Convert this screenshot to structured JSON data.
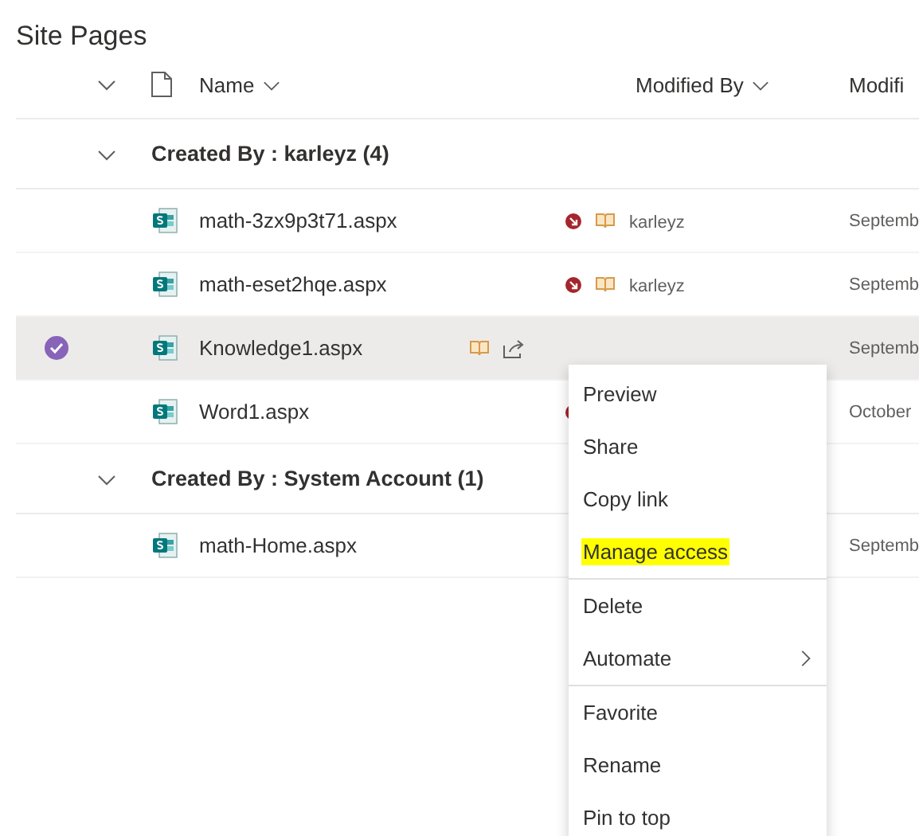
{
  "title": "Site Pages",
  "columns": [
    {
      "label": "Name",
      "sortable": true
    },
    {
      "label": "Modified By",
      "sortable": true
    },
    {
      "label": "Modifi",
      "sortable": false
    }
  ],
  "groups": [
    {
      "label": "Created By : karleyz (4)",
      "expanded": true,
      "rows": [
        {
          "name": "math-3zx9p3t71.aspx",
          "selected": false,
          "hovered": false,
          "checked_out": true,
          "book": true,
          "modified_by": "karleyz",
          "modified": "Septemb"
        },
        {
          "name": "math-eset2hqe.aspx",
          "selected": false,
          "hovered": false,
          "checked_out": true,
          "book": true,
          "modified_by": "karleyz",
          "modified": "Septemb"
        },
        {
          "name": "Knowledge1.aspx",
          "selected": true,
          "hovered": true,
          "checked_out": false,
          "book": false,
          "modified": "Septemb"
        },
        {
          "name": "Word1.aspx",
          "selected": false,
          "hovered": false,
          "checked_out": true,
          "book": false,
          "modified": "October"
        }
      ]
    },
    {
      "label": "Created By : System Account (1)",
      "expanded": true,
      "rows": [
        {
          "name": "math-Home.aspx",
          "selected": false,
          "hovered": false,
          "checked_out": false,
          "book": false,
          "modified": "Septemb"
        }
      ]
    }
  ],
  "context_menu": [
    {
      "kind": "item",
      "label": "Preview",
      "highlighted": false,
      "submenu": false
    },
    {
      "kind": "item",
      "label": "Share",
      "highlighted": false,
      "submenu": false
    },
    {
      "kind": "item",
      "label": "Copy link",
      "highlighted": false,
      "submenu": false
    },
    {
      "kind": "item",
      "label": "Manage access",
      "highlighted": true,
      "submenu": false
    },
    {
      "kind": "separator"
    },
    {
      "kind": "item",
      "label": "Delete",
      "highlighted": false,
      "submenu": false
    },
    {
      "kind": "item",
      "label": "Automate",
      "highlighted": false,
      "submenu": true
    },
    {
      "kind": "separator"
    },
    {
      "kind": "item",
      "label": "Favorite",
      "highlighted": false,
      "submenu": false
    },
    {
      "kind": "item",
      "label": "Rename",
      "highlighted": false,
      "submenu": false
    },
    {
      "kind": "item",
      "label": "Pin to top",
      "highlighted": false,
      "submenu": false
    }
  ]
}
